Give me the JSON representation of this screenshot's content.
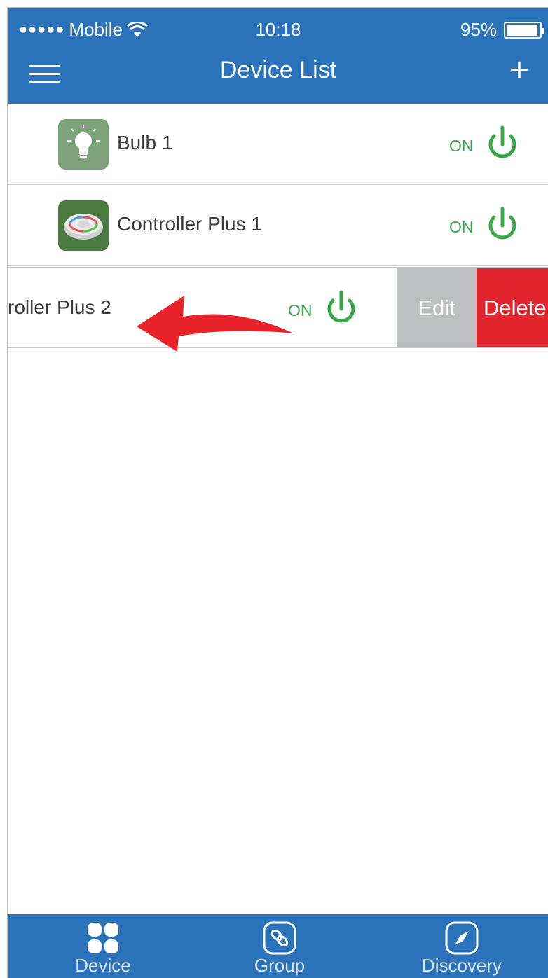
{
  "status_bar": {
    "carrier_dots": "●●●●●",
    "carrier": "Mobile",
    "time": "10:18",
    "battery": "95%"
  },
  "navbar": {
    "title": "Device List",
    "add_label": "+"
  },
  "devices": [
    {
      "name": "Bulb 1",
      "state": "ON",
      "icon": "bulb-icon"
    },
    {
      "name": "Controller Plus 1",
      "state": "ON",
      "icon": "controller-icon"
    },
    {
      "name": "roller Plus 2",
      "state": "ON",
      "icon": "controller-icon"
    }
  ],
  "swipe_actions": {
    "edit": "Edit",
    "delete": "Delete"
  },
  "tabs": [
    {
      "label": "Device",
      "icon": "grid-icon"
    },
    {
      "label": "Group",
      "icon": "link-icon"
    },
    {
      "label": "Discovery",
      "icon": "compass-icon"
    }
  ],
  "colors": {
    "primary": "#2a72b9",
    "on_green": "#3aa84a",
    "edit_gray": "#bebfc1",
    "delete_red": "#e3262e",
    "arrow_red": "#e8232a"
  }
}
